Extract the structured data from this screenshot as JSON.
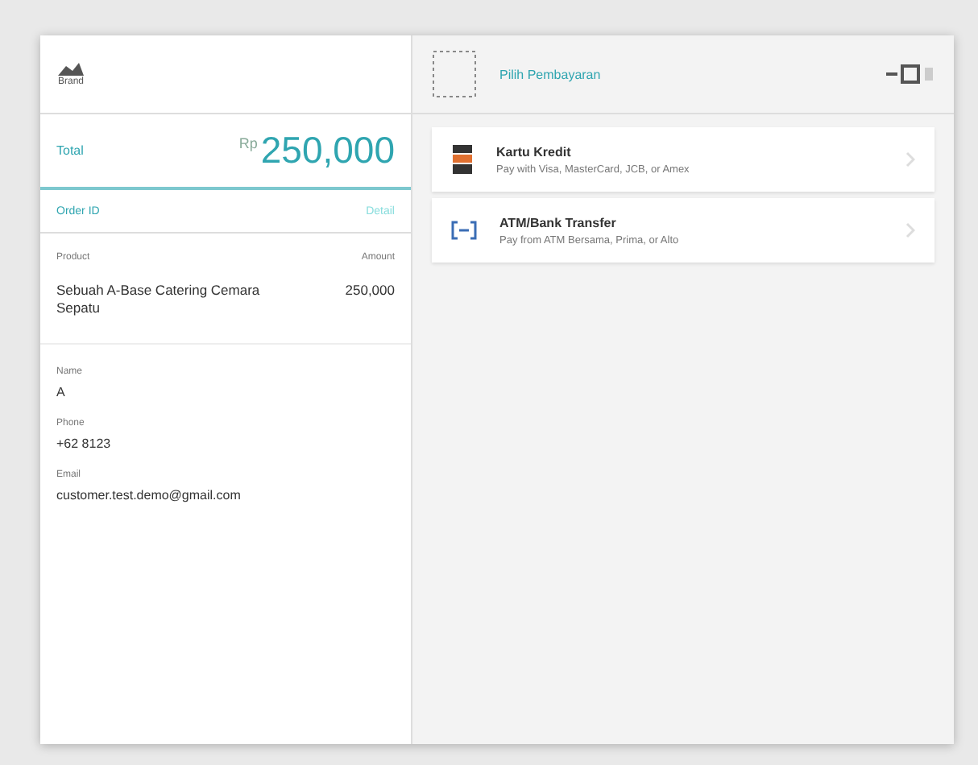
{
  "merchant": {
    "logo_text": "Brand"
  },
  "total": {
    "label": "Total",
    "currency": "Rp",
    "amount": "250,000"
  },
  "order": {
    "label": "Order ID",
    "action": "Detail"
  },
  "items_header": {
    "name": "Product",
    "amount": "Amount"
  },
  "items": [
    {
      "name": "Sebuah A-Base Catering Cemara Sepatu",
      "amount": "250,000"
    }
  ],
  "customer": [
    {
      "label": "Name",
      "value": "A"
    },
    {
      "label": "Phone",
      "value": "+62 8123"
    },
    {
      "label": "Email",
      "value": "customer.test.demo@gmail.com"
    }
  ],
  "header": {
    "title": "Pilih Pembayaran"
  },
  "methods": [
    {
      "kind": "card",
      "title": "Kartu Kredit",
      "subtitle": "Pay with Visa, MasterCard, JCB, or Amex"
    },
    {
      "kind": "bank",
      "title": "ATM/Bank Transfer",
      "subtitle": "Pay from ATM Bersama, Prima, or Alto"
    }
  ]
}
